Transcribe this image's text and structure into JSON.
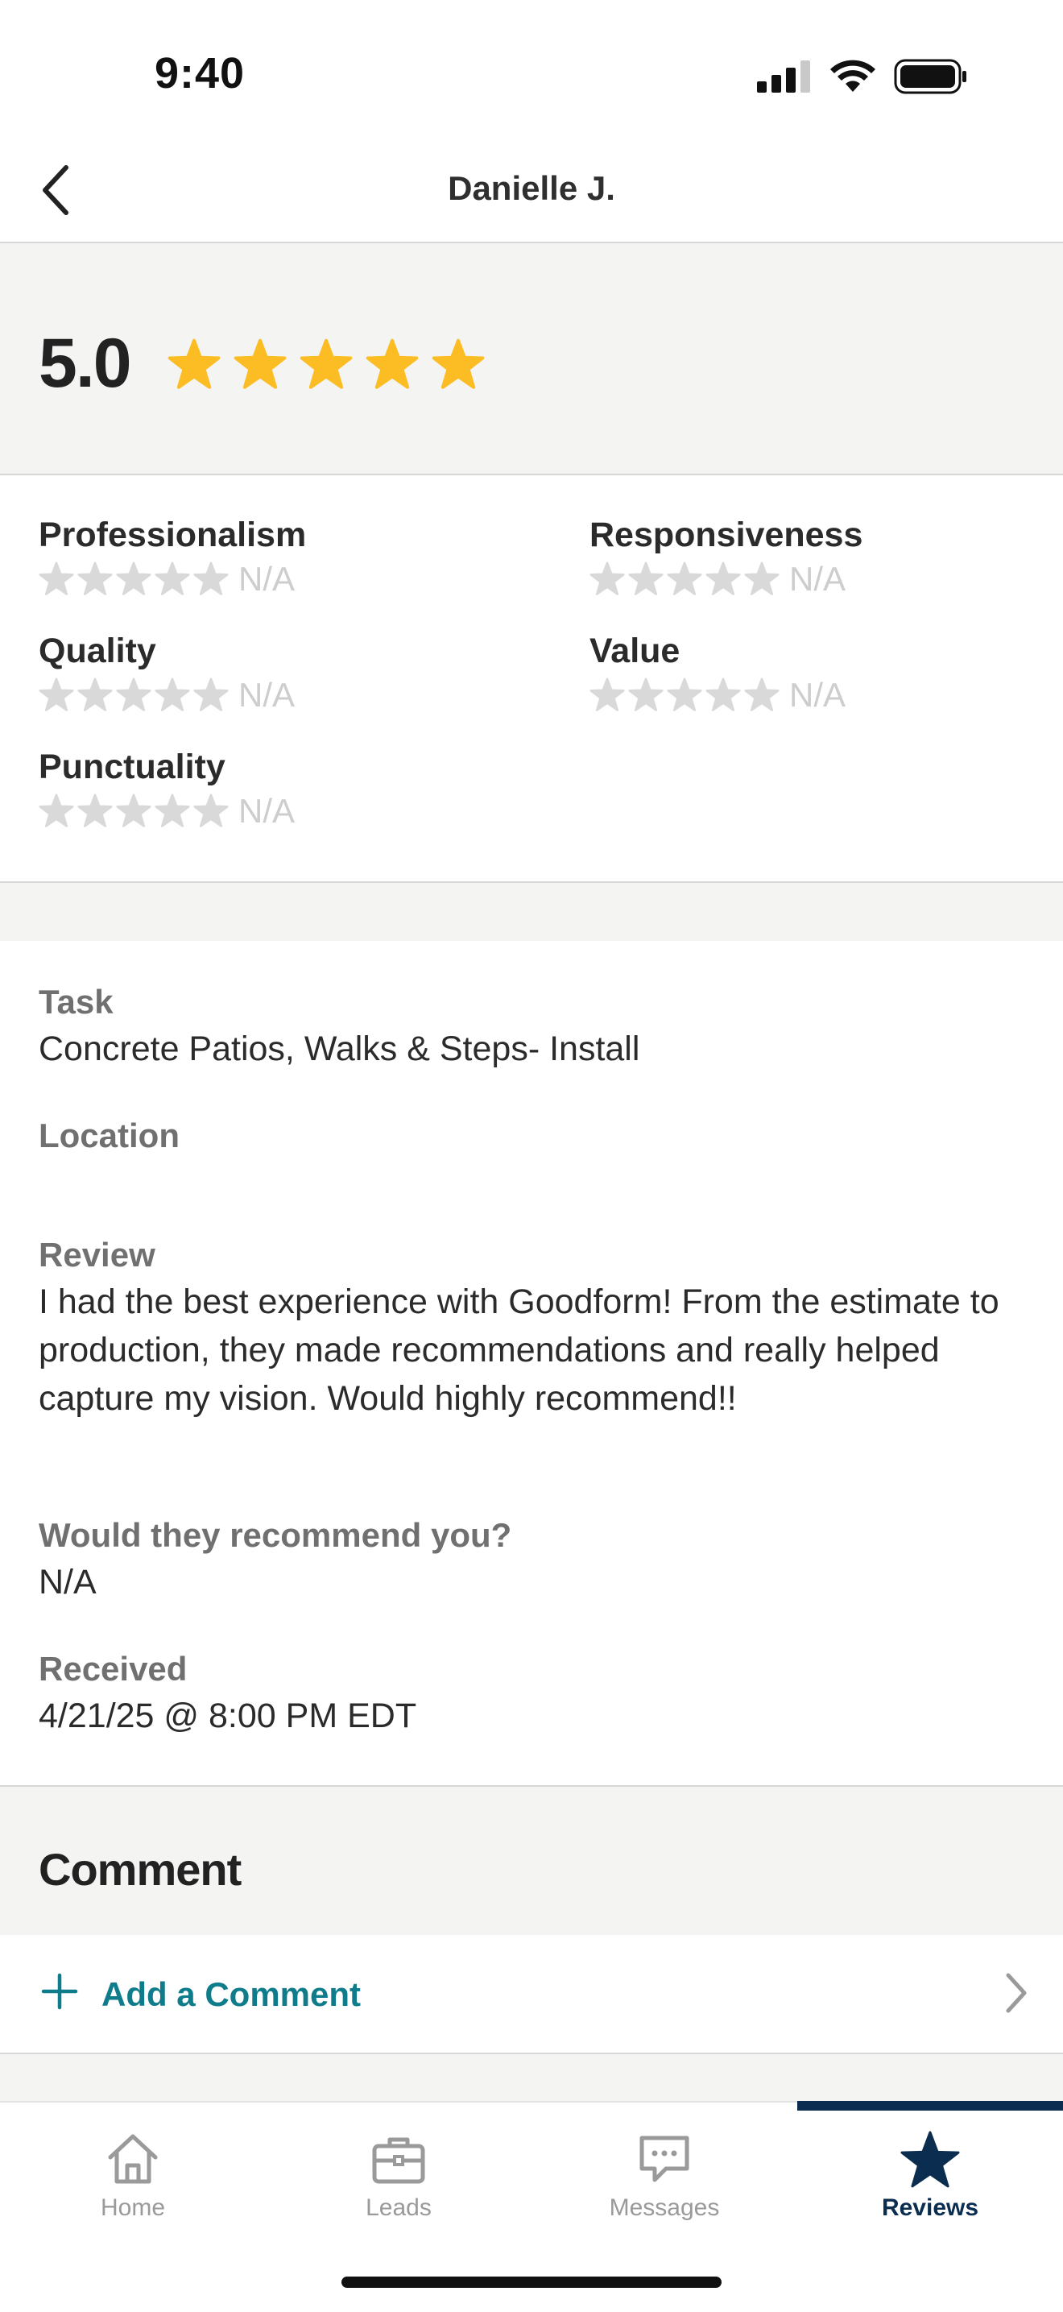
{
  "status_bar": {
    "time": "9:40"
  },
  "header": {
    "title": "Danielle J."
  },
  "overall": {
    "rating": "5.0",
    "stars": 5,
    "star_color": "#fbbd23"
  },
  "sub_ratings": [
    {
      "label": "Professionalism",
      "value": "N/A"
    },
    {
      "label": "Responsiveness",
      "value": "N/A"
    },
    {
      "label": "Quality",
      "value": "N/A"
    },
    {
      "label": "Value",
      "value": "N/A"
    },
    {
      "label": "Punctuality",
      "value": "N/A"
    }
  ],
  "details": {
    "task_label": "Task",
    "task_value": "Concrete Patios, Walks & Steps- Install",
    "location_label": "Location",
    "location_value": "",
    "review_label": "Review",
    "review_value": "I had the best experience with Goodform! From the estimate to production, they made recommendations and really helped capture my vision. Would highly recommend!!",
    "recommend_label": "Would they recommend you?",
    "recommend_value": "N/A",
    "received_label": "Received",
    "received_value": "4/21/25 @ 8:00 PM EDT"
  },
  "comment": {
    "title": "Comment",
    "add_label": "Add a Comment"
  },
  "tabs": [
    {
      "label": "Home",
      "icon": "home-icon"
    },
    {
      "label": "Leads",
      "icon": "briefcase-icon"
    },
    {
      "label": "Messages",
      "icon": "chat-icon"
    },
    {
      "label": "Reviews",
      "icon": "star-icon",
      "active": true
    }
  ],
  "colors": {
    "accent": "#0f7c8c",
    "nav_active": "#0b2d4f",
    "star": "#fbbd23",
    "star_empty": "#d9d9d9"
  }
}
